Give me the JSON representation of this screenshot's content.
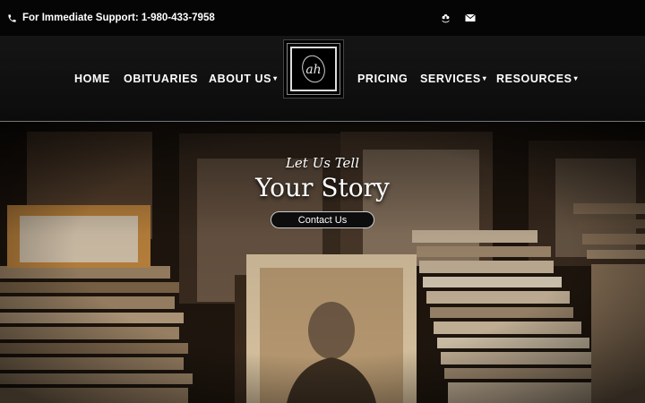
{
  "topbar": {
    "support_text": "For Immediate Support: 1-980-433-7958",
    "icons": [
      "phone-icon",
      "flower-icon",
      "envelope-icon"
    ]
  },
  "nav": {
    "home": "HOME",
    "obituaries": "OBITUARIES",
    "about": "ABOUT US",
    "pricing": "PRICING",
    "services": "SERVICES",
    "resources": "RESOURCES",
    "caret": "▾"
  },
  "logo": {
    "monogram": "ah"
  },
  "hero": {
    "subtitle": "Let Us Tell",
    "title": "Your Story",
    "button_label": "Contact Us"
  },
  "colors": {
    "topbar": "#050505",
    "nav": "#111111",
    "text": "#ffffff",
    "hero_tone": "#4a3a28"
  }
}
